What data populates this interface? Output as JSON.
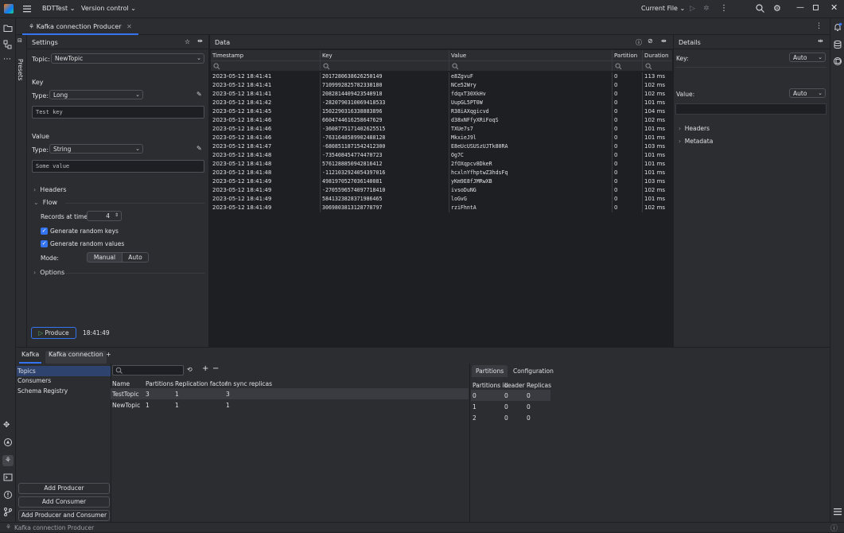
{
  "titlebar": {
    "project": "BDTTest",
    "vcs": "Version control",
    "run_config": "Current File"
  },
  "editor_tab": {
    "label": "Kafka connection Producer"
  },
  "presets_label": "Presets",
  "settings": {
    "title": "Settings",
    "topic_label": "Topic:",
    "topic_value": "NewTopic",
    "key_section": "Key",
    "key_type_label": "Type:",
    "key_type_value": "Long",
    "key_placeholder": "Test key",
    "value_section": "Value",
    "value_type_label": "Type:",
    "value_type_value": "String",
    "value_placeholder": "Some value",
    "headers_label": "Headers",
    "flow_label": "Flow",
    "records_label": "Records at time:",
    "records_value": "4",
    "gen_keys_label": "Generate random keys",
    "gen_values_label": "Generate random values",
    "mode_label": "Mode:",
    "mode_manual": "Manual",
    "mode_auto": "Auto",
    "options_label": "Options",
    "produce_button": "Produce",
    "produce_time": "18:41:49"
  },
  "data": {
    "title": "Data",
    "columns": [
      "Timestamp",
      "Key",
      "Value",
      "Partition",
      "Duration"
    ],
    "rows": [
      [
        "2023-05-12 18:41:41",
        "2017280638626250149",
        "e8ZgvuF",
        "0",
        "113 ms"
      ],
      [
        "2023-05-12 18:41:41",
        "7109992825782338180",
        "NCe52Wry",
        "0",
        "102 ms"
      ],
      [
        "2023-05-12 18:41:41",
        "2082814409423540918",
        "fdqxT30XkHv",
        "0",
        "102 ms"
      ],
      [
        "2023-05-12 18:41:42",
        "-282079031006941853З",
        "UupGL5PT0W",
        "0",
        "101 ms"
      ],
      [
        "2023-05-12 18:41:45",
        "1502290316338883896",
        "R38iAXqgicvd",
        "0",
        "104 ms"
      ],
      [
        "2023-05-12 18:41:46",
        "6604744616258647629",
        "d38xNFfyXRiFoqS",
        "0",
        "102 ms"
      ],
      [
        "2023-05-12 18:41:46",
        "-3608775171402625515",
        "TXUe7s7",
        "0",
        "101 ms"
      ],
      [
        "2023-05-12 18:41:46",
        "-7631648589902488128",
        "MkxieJ9l",
        "0",
        "101 ms"
      ],
      [
        "2023-05-12 18:41:47",
        "-6808511871542412300",
        "E8eUcUSUSzUJTk80RA",
        "0",
        "103 ms"
      ],
      [
        "2023-05-12 18:41:48",
        "-735408454774470723",
        "Og7C",
        "0",
        "101 ms"
      ],
      [
        "2023-05-12 18:41:48",
        "5761288850942816412",
        "2fOXqpcv8DkeR",
        "0",
        "101 ms"
      ],
      [
        "2023-05-12 18:41:48",
        "-1121032924054397016",
        "hcxlnYfhptwZ3hdsFq",
        "0",
        "101 ms"
      ],
      [
        "2023-05-12 18:41:49",
        "4981970527036140081",
        "yKm9E8fJMRwXB",
        "0",
        "103 ms"
      ],
      [
        "2023-05-12 18:41:49",
        "-2705596574097718410",
        "ivsoDuNG",
        "0",
        "102 ms"
      ],
      [
        "2023-05-12 18:41:49",
        "5841323828371986465",
        "loGvG",
        "0",
        "101 ms"
      ],
      [
        "2023-05-12 18:41:49",
        "3069803813128778797",
        "rziFhntA",
        "0",
        "102 ms"
      ]
    ]
  },
  "details": {
    "title": "Details",
    "key_label": "Key:",
    "key_mode": "Auto",
    "value_label": "Value:",
    "value_mode": "Auto",
    "headers_label": "Headers",
    "metadata_label": "Metadata"
  },
  "bottom": {
    "tabs": [
      "Kafka",
      "Kafka connection"
    ],
    "add_tab": "+",
    "nav": [
      "Topics",
      "Consumers",
      "Schema Registry"
    ],
    "topics_columns": [
      "Name",
      "Partitions",
      "Replication factor",
      "In sync replicas"
    ],
    "topics_rows": [
      [
        "TestTopic",
        "3",
        "1",
        "3"
      ],
      [
        "NewTopic",
        "1",
        "1",
        "1"
      ]
    ],
    "right_tabs": [
      "Partitions",
      "Configuration"
    ],
    "partition_columns": [
      "Partitions id",
      "Leader",
      "Replicas"
    ],
    "partition_rows": [
      [
        "0",
        "0",
        "0"
      ],
      [
        "1",
        "0",
        "0"
      ],
      [
        "2",
        "0",
        "0"
      ]
    ],
    "add_producer": "Add Producer",
    "add_consumer": "Add Consumer",
    "add_both": "Add Producer and Consumer"
  },
  "status": {
    "text": "Kafka connection Producer"
  }
}
